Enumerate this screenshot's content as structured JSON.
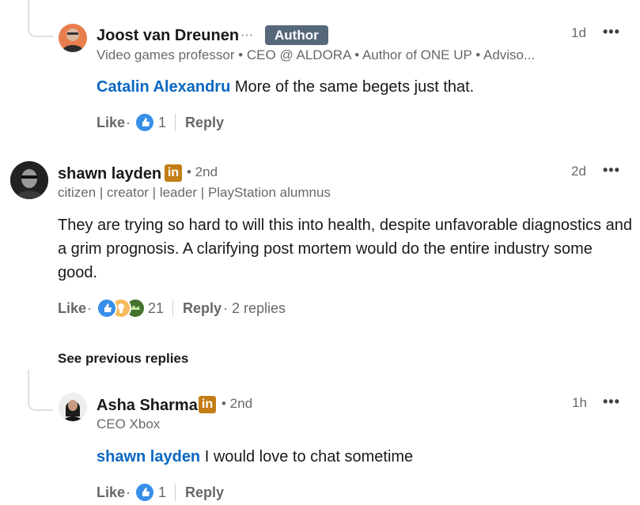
{
  "comments": [
    {
      "name": "Joost van Dreunen",
      "name_suffix": "···",
      "badge": "Author",
      "headline": "Video games professor • CEO @ ALDORA • Author of ONE UP • Adviso...",
      "time": "1d",
      "mention": "Catalin Alexandru",
      "text": " More of the same begets just that.",
      "like_label": "Like",
      "dot": "·",
      "reaction_count": "1",
      "reply_label": "Reply"
    },
    {
      "name": "shawn layden",
      "degree": "• 2nd",
      "headline": "citizen | creator | leader | PlayStation alumnus",
      "time": "2d",
      "text": "They are trying so hard to will this into health, despite unfavorable diagnostics and a grim prognosis. A clarifying post mortem would do the entire industry some good.",
      "like_label": "Like",
      "dot": "·",
      "reaction_count": "21",
      "reply_label": "Reply",
      "replies_label": "· 2 replies"
    },
    {
      "name": "Asha Sharma",
      "degree": "• 2nd",
      "headline": "CEO Xbox",
      "time": "1h",
      "mention": "shawn layden",
      "text": " I would love to chat sometime",
      "like_label": "Like",
      "dot": "·",
      "reaction_count": "1",
      "reply_label": "Reply"
    }
  ],
  "see_previous": "See previous replies",
  "more_icon": "•••",
  "linkedin_icon": "in",
  "colors": {
    "mention": "#0a66c2",
    "badge": "#56687a",
    "linkedin_gold": "#c37d16"
  }
}
